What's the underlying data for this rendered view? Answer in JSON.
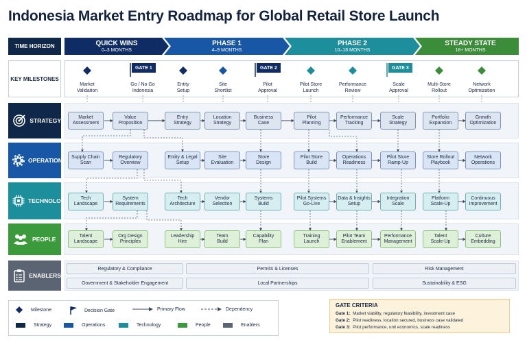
{
  "title": "Indonesia Market Entry Roadmap for Global Retail Store Launch",
  "time_horizon_label": "TIME HORIZON",
  "key_milestones_label": "KEY MILESTONES",
  "phases": [
    {
      "name": "QUICK WINS",
      "range": "0–3 MONTHS",
      "color": "#0f2d64"
    },
    {
      "name": "PHASE 1",
      "range": "4–9 MONTHS",
      "color": "#1757a6"
    },
    {
      "name": "PHASE 2",
      "range": "10–18 MONTHS",
      "color": "#1d8f9c"
    },
    {
      "name": "STEADY STATE",
      "range": "18+ MONTHS",
      "color": "#3b8d3a"
    }
  ],
  "milestones": [
    {
      "label": "Market\nValidation",
      "kind": "milestone"
    },
    {
      "label": "Go / No Go\nIndonesia",
      "kind": "gate",
      "gate": "GATE 1"
    },
    {
      "label": "Entity\nSetup",
      "kind": "milestone"
    },
    {
      "label": "Site\nShortlist",
      "kind": "milestone"
    },
    {
      "label": "Pilot\nApproval",
      "kind": "gate",
      "gate": "GATE 2"
    },
    {
      "label": "Pilot Store\nLaunch",
      "kind": "milestone"
    },
    {
      "label": "Performance\nReview",
      "kind": "milestone"
    },
    {
      "label": "Scale\nApproval",
      "kind": "gate",
      "gate": "GATE 3"
    },
    {
      "label": "Multi-Store\nRollout",
      "kind": "milestone"
    },
    {
      "label": "Network\nOptimization",
      "kind": "milestone"
    }
  ],
  "rows": [
    {
      "label": "STRATEGY",
      "icon": "target-icon",
      "color": "#0f2748",
      "boxes": [
        "Market\nAssessment",
        "Value\nProposition",
        "Entry\nStrategy",
        "Location\nStrategy",
        "Business\nCase",
        "Pilot\nPlanning",
        "Performance\nTracking",
        "Scale\nStrategy",
        "Portfolio\nExpansion",
        "Growth\nOptimization"
      ]
    },
    {
      "label": "OPERATIONS",
      "icon": "gear-icon",
      "color": "#1757a6",
      "boxes": [
        "Supply Chain\nScan",
        "Regulatory\nOverview",
        "Entity & Legal\nSetup",
        "Site\nEvaluation",
        "Store\nDesign",
        "Pilot Store\nBuild",
        "Operations\nReadiness",
        "Pilot Store\nRamp-Up",
        "Store Rollout\nPlaybook",
        "Network\nOperations"
      ]
    },
    {
      "label": "TECHNOLOGY",
      "icon": "chip-icon",
      "color": "#1d8f9c",
      "boxes": [
        "Tech\nLandscape",
        "System\nRequirements",
        "Tech\nArchitecture",
        "Vendor\nSelection",
        "Systems\nBuild",
        "Pilot Systems\nGo-Live",
        "Data & Insights\nSetup",
        "Integration\nScale",
        "Platform\nScale-Up",
        "Continuous\nImprovement"
      ]
    },
    {
      "label": "PEOPLE",
      "icon": "people-icon",
      "color": "#3b9a3c",
      "boxes": [
        "Talent\nLandscape",
        "Org Design\nPrinciples",
        "Leadership\nHire",
        "Team\nBuild",
        "Capability\nPlan",
        "Training\nLaunch",
        "Pilot Team\nEnablement",
        "Performance\nManagement",
        "Talent\nScale-Up",
        "Culture\nEmbedding"
      ]
    },
    {
      "label": "ENABLERS",
      "icon": "clipboard-icon",
      "color": "#5a6472",
      "boxes": []
    }
  ],
  "enablers": [
    "Regulatory & Compliance",
    "Permits & Licenses",
    "Risk Management",
    "Government & Stakeholder Engagement",
    "Local Partnerships",
    "Sustainability & ESG"
  ],
  "legend": {
    "milestone": "Milestone",
    "decision_gate": "Decision Gate",
    "primary_flow": "Primary Flow",
    "dependency": "Dependency",
    "strategy": "Strategy",
    "operations": "Operations",
    "technology": "Technology",
    "people": "People",
    "enablers": "Enablers",
    "colors": {
      "strategy": "#0f2748",
      "operations": "#1757a6",
      "technology": "#1d8f9c",
      "people": "#3b9a3c",
      "enablers": "#5a6472"
    }
  },
  "gate_criteria": {
    "title": "GATE CRITERIA",
    "items": [
      {
        "gate": "Gate 1:",
        "text": "Market viability, regulatory feasibility, investment case"
      },
      {
        "gate": "Gate 2:",
        "text": "Pilot readiness, location secured, business case validated"
      },
      {
        "gate": "Gate 3:",
        "text": "Pilot performance, unit economics, scale readiness"
      }
    ]
  }
}
